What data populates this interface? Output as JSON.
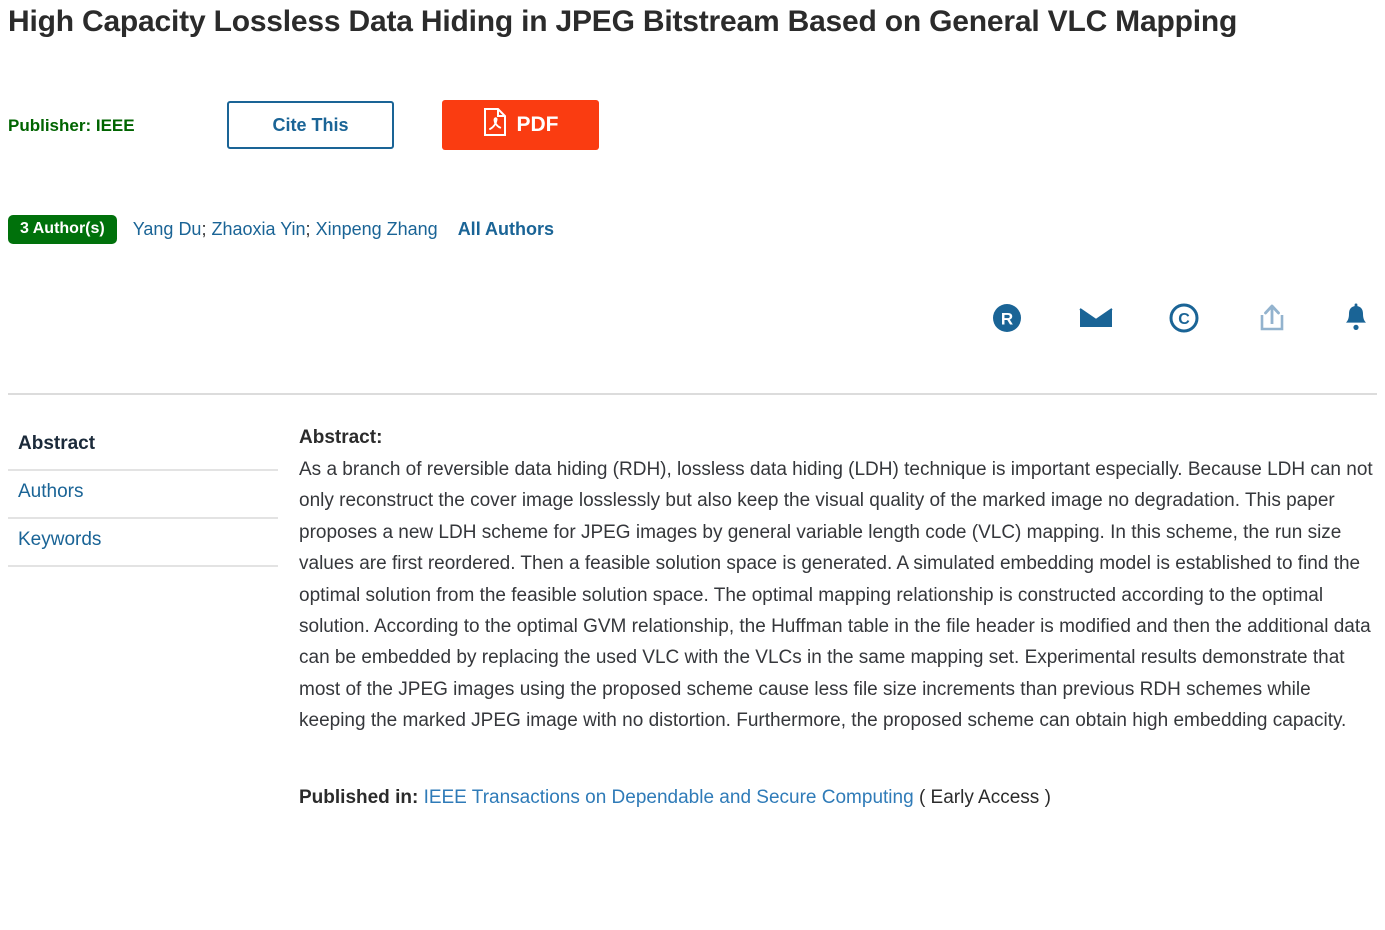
{
  "paper": {
    "title": "High Capacity Lossless Data Hiding in JPEG Bitstream Based on General VLC Mapping",
    "publisher": "Publisher: IEEE"
  },
  "actions": {
    "cite_label": "Cite This",
    "pdf_label": "PDF",
    "pdf_icon": "pdf-document-icon",
    "pdf_color": "#fa3c11",
    "cite_border_color": "#1a6496"
  },
  "authors": {
    "badge": "3 Author(s)",
    "badge_color": "#00710b",
    "list": [
      {
        "name": "Yang Du"
      },
      {
        "name": "Zhaoxia Yin"
      },
      {
        "name": "Xinpeng Zhang"
      }
    ],
    "separator": ";",
    "all_authors_label": "All Authors"
  },
  "toolbar": {
    "icons": [
      {
        "name": "researchgate-icon",
        "glyph": "R",
        "color": "#1a6496"
      },
      {
        "name": "email-icon",
        "glyph": "envelope",
        "color": "#1a6496"
      },
      {
        "name": "copyright-icon",
        "glyph": "C",
        "color": "#1a6496"
      },
      {
        "name": "share-icon",
        "glyph": "share-arrow",
        "color": "#93b3ce"
      },
      {
        "name": "alerts-bell-icon",
        "glyph": "bell",
        "color": "#1a6496"
      }
    ]
  },
  "sidebar": {
    "items": [
      {
        "label": "Abstract",
        "active": true
      },
      {
        "label": "Authors",
        "active": false
      },
      {
        "label": "Keywords",
        "active": false
      }
    ]
  },
  "main": {
    "abstract_label": "Abstract:",
    "abstract_text": "As a branch of reversible data hiding (RDH), lossless data hiding (LDH) technique is important especially. Because LDH can not only reconstruct the cover image losslessly but also keep the visual quality of the marked image no degradation. This paper proposes a new LDH scheme for JPEG images by general variable length code (VLC) mapping. In this scheme, the run size values are first reordered. Then a feasible solution space is generated. A simulated embedding model is established to find the optimal solution from the feasible solution space. The optimal mapping relationship is constructed according to the optimal solution. According to the optimal GVM relationship, the Huffman table in the file header is modified and then the additional data can be embedded by replacing the used VLC with the VLCs in the same mapping set. Experimental results demonstrate that most of the JPEG images using the proposed scheme cause less file size increments than previous RDH schemes while keeping the marked JPEG image with no distortion. Furthermore, the proposed scheme can obtain high embedding capacity.",
    "published_in_label": "Published in:",
    "journal_name": "IEEE Transactions on Dependable and Secure Computing",
    "early_access": "( Early Access )"
  }
}
